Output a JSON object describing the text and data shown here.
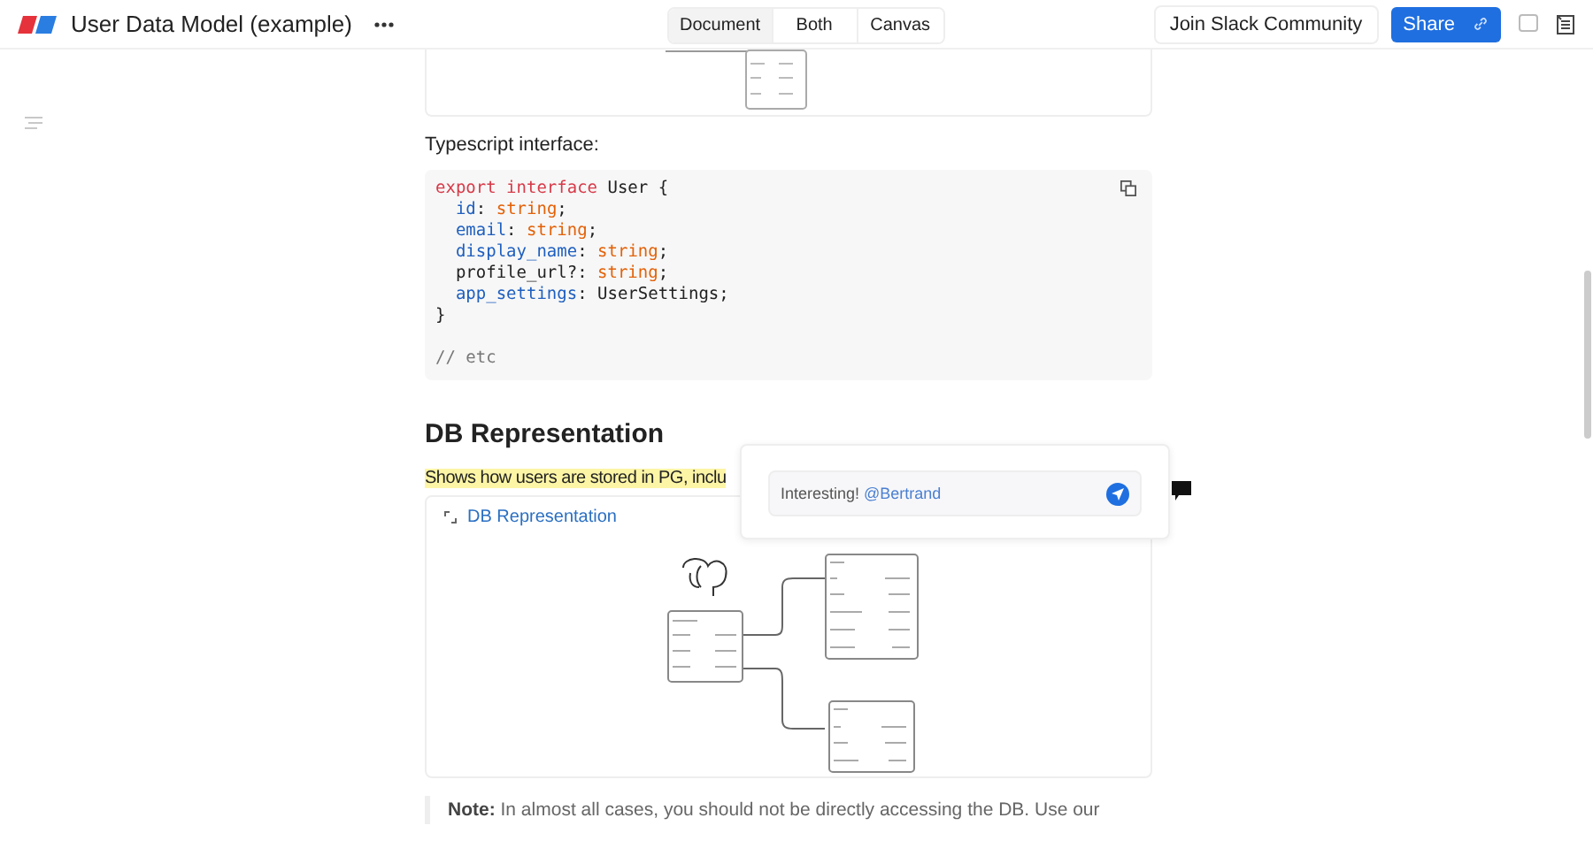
{
  "header": {
    "title": "User Data Model (example)",
    "view_tabs": [
      {
        "label": "Document",
        "selected": true
      },
      {
        "label": "Both",
        "selected": false
      },
      {
        "label": "Canvas",
        "selected": false
      }
    ],
    "community_button": "Join Slack Community",
    "share_button": "Share"
  },
  "document": {
    "intro_label": "Typescript interface:",
    "code_lines": [
      [
        {
          "text": "export interface",
          "kind": "keyword"
        },
        {
          "text": " User {",
          "kind": "plain"
        }
      ],
      [
        {
          "text": "  id",
          "kind": "property"
        },
        {
          "text": ": ",
          "kind": "plain"
        },
        {
          "text": "string",
          "kind": "type"
        },
        {
          "text": ";",
          "kind": "plain"
        }
      ],
      [
        {
          "text": "  email",
          "kind": "property"
        },
        {
          "text": ": ",
          "kind": "plain"
        },
        {
          "text": "string",
          "kind": "type"
        },
        {
          "text": ";",
          "kind": "plain"
        }
      ],
      [
        {
          "text": "  display_name",
          "kind": "property"
        },
        {
          "text": ": ",
          "kind": "plain"
        },
        {
          "text": "string",
          "kind": "type"
        },
        {
          "text": ";",
          "kind": "plain"
        }
      ],
      [
        {
          "text": "  profile_url?: ",
          "kind": "plain"
        },
        {
          "text": "string",
          "kind": "type"
        },
        {
          "text": ";",
          "kind": "plain"
        }
      ],
      [
        {
          "text": "  app_settings",
          "kind": "property"
        },
        {
          "text": ": UserSettings;",
          "kind": "plain"
        }
      ],
      [
        {
          "text": "}",
          "kind": "plain"
        }
      ],
      [
        {
          "text": "// etc",
          "kind": "comment"
        }
      ]
    ],
    "heading": "DB Representation",
    "highlighted_text": "Shows how users are stored in PG, inclu",
    "embed_link": "DB Representation",
    "note": "**Note:**  In almost all cases, you should not be directly accessing the DB. Use our"
  },
  "comment": {
    "text": "Interesting!",
    "mention": "@Bertrand"
  }
}
